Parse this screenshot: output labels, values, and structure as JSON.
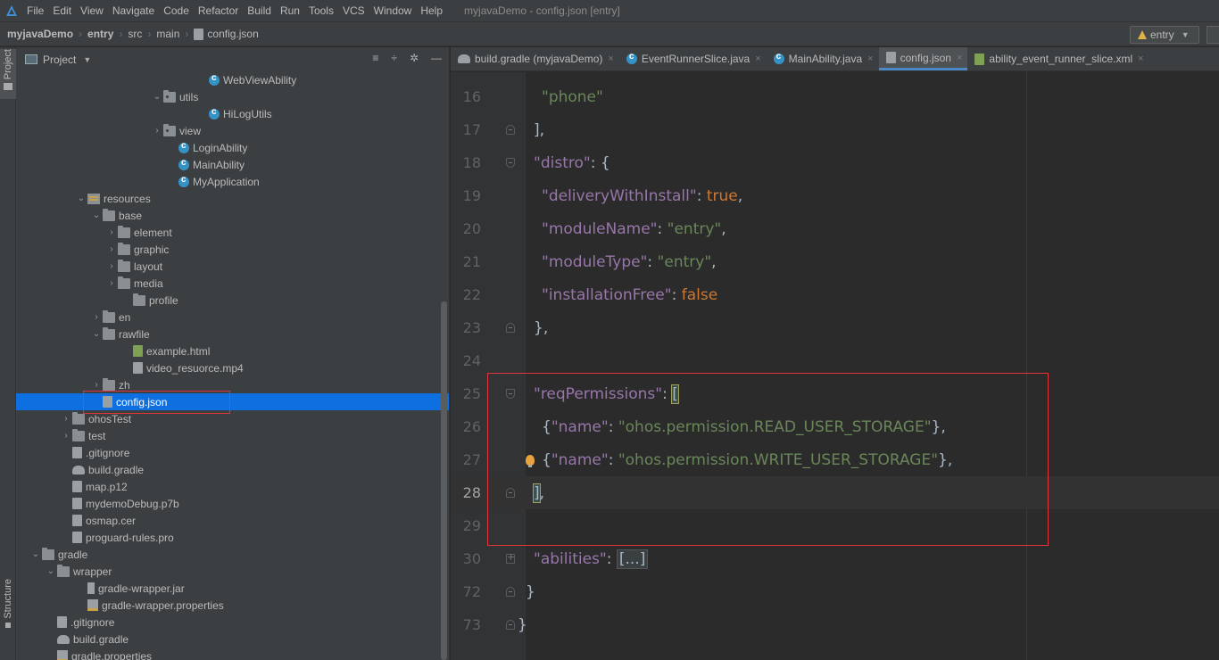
{
  "menubar": {
    "items": [
      "File",
      "Edit",
      "View",
      "Navigate",
      "Code",
      "Refactor",
      "Build",
      "Run",
      "Tools",
      "VCS",
      "Window",
      "Help"
    ],
    "window_title": "myjavaDemo - config.json [entry]"
  },
  "breadcrumb": [
    "myjavaDemo",
    "entry",
    "src",
    "main",
    "config.json"
  ],
  "run_config": {
    "label": "entry"
  },
  "stripe": {
    "project_label": "Project",
    "structure_label": "Structure"
  },
  "project_panel": {
    "title": "Project",
    "tree": [
      {
        "label": "WebViewAbility",
        "icon": "class-icon",
        "depth": 12,
        "arrow": ""
      },
      {
        "label": "utils",
        "icon": "package-folder-icon",
        "depth": 9,
        "arrow": "expanded"
      },
      {
        "label": "HiLogUtils",
        "icon": "class-icon",
        "depth": 12,
        "arrow": ""
      },
      {
        "label": "view",
        "icon": "package-folder-icon",
        "depth": 9,
        "arrow": "collapsed"
      },
      {
        "label": "LoginAbility",
        "icon": "class-icon",
        "depth": 10,
        "arrow": ""
      },
      {
        "label": "MainAbility",
        "icon": "class-icon",
        "depth": 10,
        "arrow": ""
      },
      {
        "label": "MyApplication",
        "icon": "class-icon",
        "depth": 10,
        "arrow": ""
      },
      {
        "label": "resources",
        "icon": "resources-folder-icon",
        "depth": 4,
        "arrow": "expanded"
      },
      {
        "label": "base",
        "icon": "folder-icon",
        "depth": 5,
        "arrow": "expanded"
      },
      {
        "label": "element",
        "icon": "folder-icon",
        "depth": 6,
        "arrow": "collapsed"
      },
      {
        "label": "graphic",
        "icon": "folder-icon",
        "depth": 6,
        "arrow": "collapsed"
      },
      {
        "label": "layout",
        "icon": "folder-icon",
        "depth": 6,
        "arrow": "collapsed"
      },
      {
        "label": "media",
        "icon": "folder-icon",
        "depth": 6,
        "arrow": "collapsed"
      },
      {
        "label": "profile",
        "icon": "folder-icon",
        "depth": 7,
        "arrow": ""
      },
      {
        "label": "en",
        "icon": "folder-icon",
        "depth": 5,
        "arrow": "collapsed"
      },
      {
        "label": "rawfile",
        "icon": "folder-icon",
        "depth": 5,
        "arrow": "expanded"
      },
      {
        "label": "example.html",
        "icon": "html-file-icon",
        "depth": 7,
        "arrow": ""
      },
      {
        "label": "video_resuorce.mp4",
        "icon": "video-file-icon",
        "depth": 7,
        "arrow": ""
      },
      {
        "label": "zh",
        "icon": "folder-icon",
        "depth": 5,
        "arrow": "collapsed"
      },
      {
        "label": "config.json",
        "icon": "json-file-icon",
        "depth": 5,
        "arrow": "",
        "selected": true
      },
      {
        "label": "ohosTest",
        "icon": "folder-icon",
        "depth": 3,
        "arrow": "collapsed"
      },
      {
        "label": "test",
        "icon": "folder-icon",
        "depth": 3,
        "arrow": "collapsed"
      },
      {
        "label": ".gitignore",
        "icon": "file-icon",
        "depth": 3,
        "arrow": ""
      },
      {
        "label": "build.gradle",
        "icon": "gradle-icon",
        "depth": 3,
        "arrow": ""
      },
      {
        "label": "map.p12",
        "icon": "file-icon",
        "depth": 3,
        "arrow": ""
      },
      {
        "label": "mydemoDebug.p7b",
        "icon": "file-icon",
        "depth": 3,
        "arrow": ""
      },
      {
        "label": "osmap.cer",
        "icon": "file-icon",
        "depth": 3,
        "arrow": ""
      },
      {
        "label": "proguard-rules.pro",
        "icon": "file-icon",
        "depth": 3,
        "arrow": ""
      },
      {
        "label": "gradle",
        "icon": "folder-icon",
        "depth": 1,
        "arrow": "expanded"
      },
      {
        "label": "wrapper",
        "icon": "folder-icon",
        "depth": 2,
        "arrow": "expanded"
      },
      {
        "label": "gradle-wrapper.jar",
        "icon": "jar-icon",
        "depth": 4,
        "arrow": ""
      },
      {
        "label": "gradle-wrapper.properties",
        "icon": "properties-icon",
        "depth": 4,
        "arrow": ""
      },
      {
        "label": ".gitignore",
        "icon": "file-icon",
        "depth": 2,
        "arrow": ""
      },
      {
        "label": "build.gradle",
        "icon": "gradle-icon",
        "depth": 2,
        "arrow": ""
      },
      {
        "label": "gradle.properties",
        "icon": "properties-icon",
        "depth": 2,
        "arrow": ""
      }
    ]
  },
  "editor_tabs": [
    {
      "label": "build.gradle (myjavaDemo)",
      "icon": "gradle-icon",
      "active": false
    },
    {
      "label": "EventRunnerSlice.java",
      "icon": "class-icon",
      "active": false
    },
    {
      "label": "MainAbility.java",
      "icon": "class-icon",
      "active": false
    },
    {
      "label": "config.json",
      "icon": "json-file-icon",
      "active": true
    },
    {
      "label": "ability_event_runner_slice.xml",
      "icon": "xml-file-icon",
      "active": false
    }
  ],
  "editor": {
    "lines": [
      {
        "num": "16",
        "tokens": [
          [
            "str",
            "\"phone\""
          ]
        ],
        "indent": 3,
        "fold": ""
      },
      {
        "num": "17",
        "tokens": [
          [
            "punc",
            "],"
          ]
        ],
        "indent": 2,
        "fold": "up"
      },
      {
        "num": "18",
        "tokens": [
          [
            "key",
            "\"distro\""
          ],
          [
            "punc",
            ": {"
          ]
        ],
        "indent": 2,
        "fold": "down"
      },
      {
        "num": "19",
        "tokens": [
          [
            "key",
            "\"deliveryWithInstall\""
          ],
          [
            "punc",
            ": "
          ],
          [
            "kw",
            "true"
          ],
          [
            "punc",
            ","
          ]
        ],
        "indent": 3,
        "fold": ""
      },
      {
        "num": "20",
        "tokens": [
          [
            "key",
            "\"moduleName\""
          ],
          [
            "punc",
            ": "
          ],
          [
            "str",
            "\"entry\""
          ],
          [
            "punc",
            ","
          ]
        ],
        "indent": 3,
        "fold": ""
      },
      {
        "num": "21",
        "tokens": [
          [
            "key",
            "\"moduleType\""
          ],
          [
            "punc",
            ": "
          ],
          [
            "str",
            "\"entry\""
          ],
          [
            "punc",
            ","
          ]
        ],
        "indent": 3,
        "fold": ""
      },
      {
        "num": "22",
        "tokens": [
          [
            "key",
            "\"installationFree\""
          ],
          [
            "punc",
            ": "
          ],
          [
            "kw",
            "false"
          ]
        ],
        "indent": 3,
        "fold": ""
      },
      {
        "num": "23",
        "tokens": [
          [
            "punc",
            "},"
          ]
        ],
        "indent": 2,
        "fold": "up"
      },
      {
        "num": "24",
        "tokens": [],
        "indent": 2,
        "fold": ""
      },
      {
        "num": "25",
        "tokens": [
          [
            "key",
            "\"reqPermissions\""
          ],
          [
            "punc",
            ": "
          ],
          [
            "bracket",
            "["
          ]
        ],
        "indent": 2,
        "fold": "down"
      },
      {
        "num": "26",
        "tokens": [
          [
            "punc",
            "{"
          ],
          [
            "key",
            "\"name\""
          ],
          [
            "punc",
            ": "
          ],
          [
            "str",
            "\"ohos.permission.READ_USER_STORAGE\""
          ],
          [
            "punc",
            "},"
          ]
        ],
        "indent": 3,
        "fold": ""
      },
      {
        "num": "27",
        "tokens": [
          [
            "punc",
            "{"
          ],
          [
            "key",
            "\"name\""
          ],
          [
            "punc",
            ": "
          ],
          [
            "str",
            "\"ohos.permission.WRITE_USER_STORAGE\""
          ],
          [
            "punc",
            "},"
          ]
        ],
        "indent": 3,
        "fold": "",
        "bulb": true
      },
      {
        "num": "28",
        "tokens": [
          [
            "bracket",
            "]"
          ],
          [
            "punc",
            ","
          ]
        ],
        "indent": 2,
        "fold": "up",
        "current": true
      },
      {
        "num": "29",
        "tokens": [],
        "indent": 2,
        "fold": ""
      },
      {
        "num": "30",
        "tokens": [
          [
            "key",
            "\"abilities\""
          ],
          [
            "punc",
            ": "
          ],
          [
            "coll",
            "[...]"
          ]
        ],
        "indent": 2,
        "fold": "plus"
      },
      {
        "num": "72",
        "tokens": [
          [
            "punc",
            "}"
          ]
        ],
        "indent": 1,
        "fold": "up"
      },
      {
        "num": "73",
        "tokens": [
          [
            "punc",
            "}"
          ]
        ],
        "indent": 0,
        "fold": "up"
      }
    ]
  },
  "colors": {
    "selection": "#0d6fe0",
    "annotation_box": "#e0363b",
    "json_key": "#9876aa",
    "json_string": "#6a8759",
    "json_keyword": "#cc7832"
  }
}
